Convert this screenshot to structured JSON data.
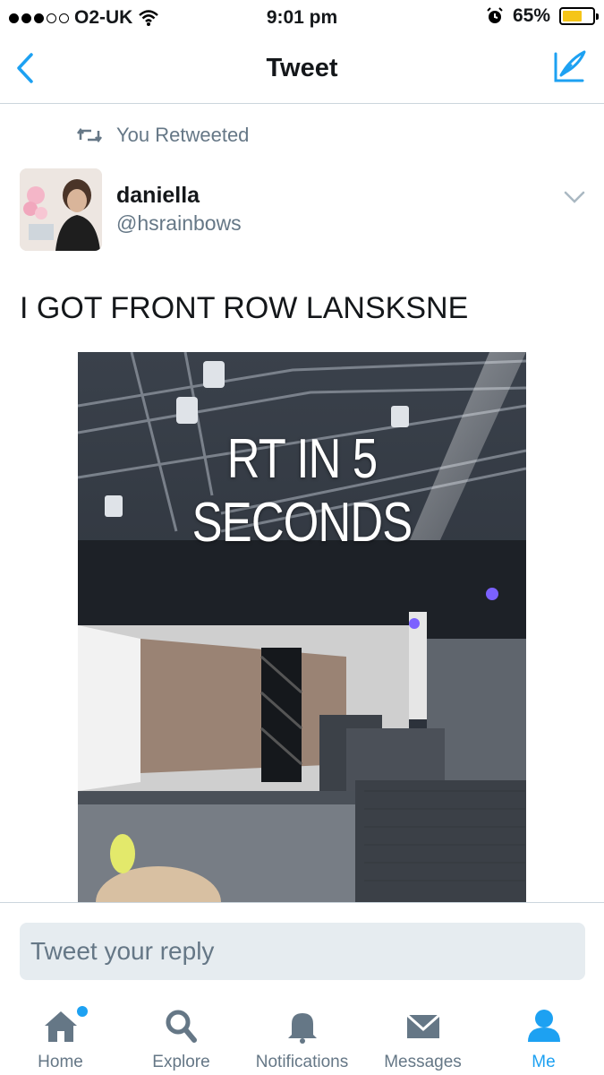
{
  "status_bar": {
    "carrier": "O2-UK",
    "time": "9:01 pm",
    "battery": "65%",
    "battery_level": 0.65,
    "signal_bars_filled": 3,
    "signal_bars_total": 5
  },
  "nav": {
    "title": "Tweet",
    "back_icon": "chevron-left-icon",
    "compose_icon": "compose-feather-icon"
  },
  "retweet_context": {
    "label": "You Retweeted"
  },
  "tweet": {
    "author_name": "daniella",
    "author_handle": "@hsrainbows",
    "text": "I GOT FRONT ROW LANSKSNE",
    "media_overlay_text": "RT IN 5 SECONDS"
  },
  "reply": {
    "placeholder": "Tweet your reply"
  },
  "tabs": [
    {
      "label": "Home",
      "icon": "home-icon",
      "active": false,
      "has_dot": true
    },
    {
      "label": "Explore",
      "icon": "search-icon",
      "active": false
    },
    {
      "label": "Notifications",
      "icon": "bell-icon",
      "active": false
    },
    {
      "label": "Messages",
      "icon": "envelope-icon",
      "active": false
    },
    {
      "label": "Me",
      "icon": "person-icon",
      "active": true
    }
  ],
  "colors": {
    "accent": "#1da1f2",
    "secondary_text": "#657786",
    "battery": "#f5c518"
  }
}
